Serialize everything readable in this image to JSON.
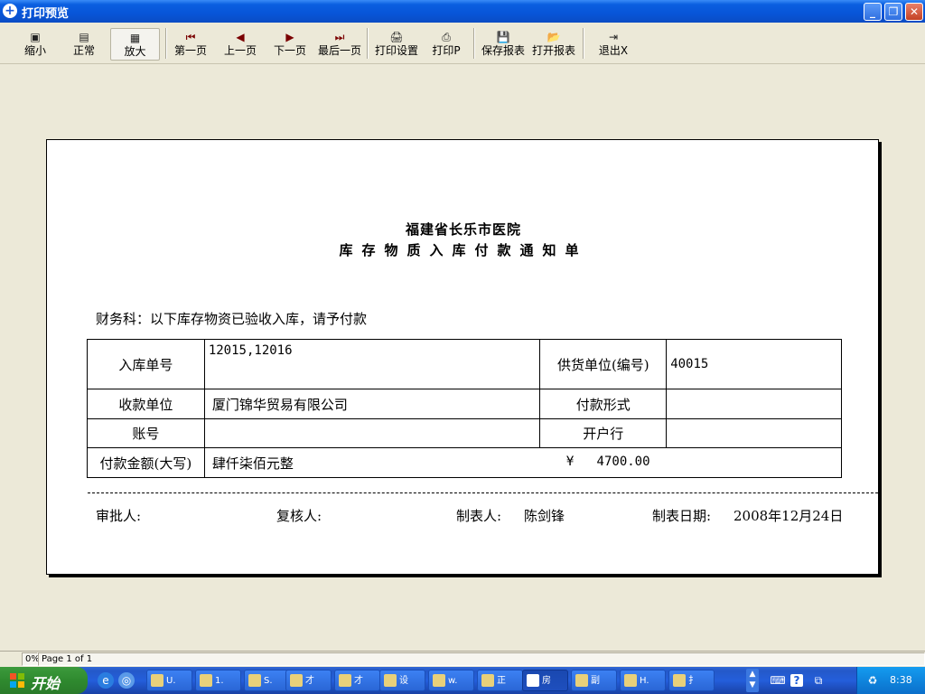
{
  "window": {
    "title": "打印预览"
  },
  "toolbar": {
    "items": [
      {
        "label": "缩小",
        "icon": "zoom-out-icon"
      },
      {
        "label": "正常",
        "icon": "normal-view-icon"
      },
      {
        "label": "放大",
        "icon": "zoom-in-icon"
      },
      {
        "label": "第一页",
        "icon": "first-page-icon"
      },
      {
        "label": "上一页",
        "icon": "prev-page-icon"
      },
      {
        "label": "下一页",
        "icon": "next-page-icon"
      },
      {
        "label": "最后一页",
        "icon": "last-page-icon"
      },
      {
        "label": "打印设置",
        "icon": "print-setup-icon"
      },
      {
        "label": "打印P",
        "icon": "printer-icon"
      },
      {
        "label": "保存报表",
        "icon": "save-icon"
      },
      {
        "label": "打开报表",
        "icon": "open-folder-icon"
      },
      {
        "label": "退出X",
        "icon": "exit-icon"
      }
    ]
  },
  "document": {
    "org": "福建省长乐市医院",
    "title": "库存物质入库付款通知单",
    "note": "财务科：以下库存物资已验收入库，请予付款",
    "rows": {
      "receipt_no_label": "入库单号",
      "receipt_no_value": "12015,12016",
      "supplier_label": "供货单位(编号)",
      "supplier_value": "40015",
      "payee_label": "收款单位",
      "payee_value": "厦门锦华贸易有限公司",
      "pay_form_label": "付款形式",
      "pay_form_value": "",
      "account_label": "账号",
      "account_value": "",
      "bank_label": "开户行",
      "bank_value": "",
      "amount_label": "付款金额(大写)",
      "amount_words": "肆仟柒佰元整",
      "amount_figures": "¥   4700.00"
    },
    "signatures": {
      "approver_label": "审批人:",
      "reviewer_label": "复核人:",
      "maker_label": "制表人:",
      "maker_name": "陈剑锋",
      "date_label": "制表日期:",
      "date_value": "2008年12月24日"
    }
  },
  "status": {
    "zoom": "0%",
    "page": "Page 1 of 1"
  },
  "taskbar": {
    "start_label": "开始",
    "tasks": [
      "U.",
      "1.",
      "S.",
      "才",
      "才",
      "设",
      "w.",
      "正",
      "房",
      "副",
      "H.",
      "扌"
    ],
    "active_task_index": 8,
    "clock": "8:38"
  }
}
